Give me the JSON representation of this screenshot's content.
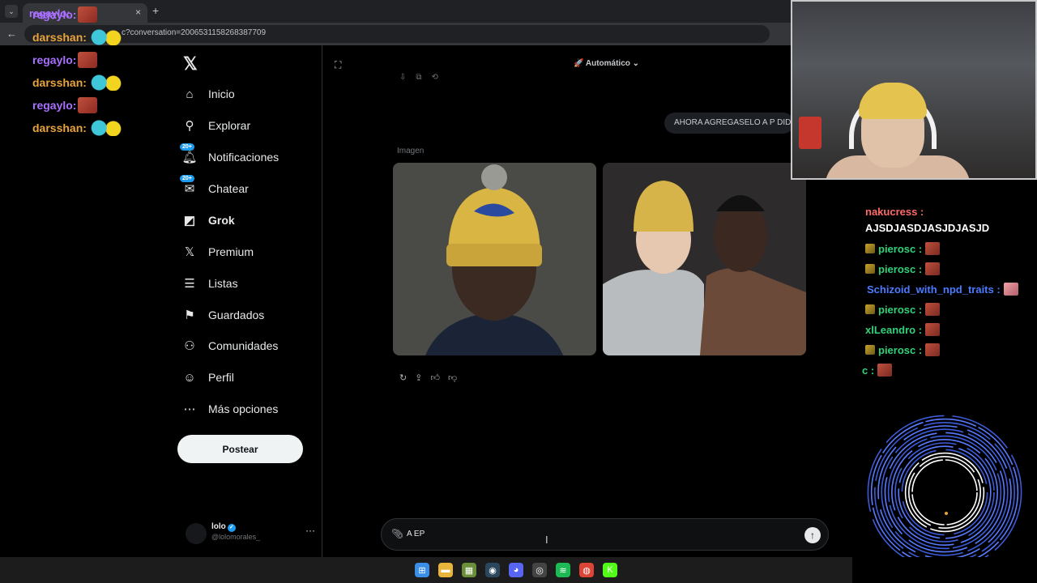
{
  "browser": {
    "tab_title": "regaylo:",
    "tab_close": "×",
    "new_tab": "+",
    "back": "←",
    "url": "c?conversation=2006531158268387709"
  },
  "stream_chat_left": [
    {
      "user": "regaylo:",
      "color": "#a970ff",
      "emote": "red"
    },
    {
      "user": "darsshan:",
      "color": "#e8a33a",
      "emote": "duck"
    },
    {
      "user": "regaylo:",
      "color": "#a970ff",
      "emote": "red"
    },
    {
      "user": "darsshan:",
      "color": "#e8a33a",
      "emote": "duck"
    },
    {
      "user": "regaylo:",
      "color": "#a970ff",
      "emote": "red"
    },
    {
      "user": "darsshan:",
      "color": "#e8a33a",
      "emote": "duck"
    }
  ],
  "sidebar": {
    "logo": "𝕏",
    "items": [
      {
        "label": "Inicio",
        "icon": "home-icon",
        "glyph": "⌂"
      },
      {
        "label": "Explorar",
        "icon": "search-icon",
        "glyph": "⚲"
      },
      {
        "label": "Notificaciones",
        "icon": "bell-icon",
        "glyph": "🔔︎",
        "badge": "20+"
      },
      {
        "label": "Chatear",
        "icon": "mail-icon",
        "glyph": "✉",
        "badge": "20+"
      },
      {
        "label": "Grok",
        "icon": "grok-icon",
        "glyph": "◩",
        "active": true
      },
      {
        "label": "Premium",
        "icon": "x-premium-icon",
        "glyph": "𝕏"
      },
      {
        "label": "Listas",
        "icon": "list-icon",
        "glyph": "☰"
      },
      {
        "label": "Guardados",
        "icon": "bookmark-icon",
        "glyph": "⚑"
      },
      {
        "label": "Comunidades",
        "icon": "communities-icon",
        "glyph": "⚇"
      },
      {
        "label": "Perfil",
        "icon": "person-icon",
        "glyph": "☺"
      },
      {
        "label": "Más opciones",
        "icon": "more-circle-icon",
        "glyph": "⋯"
      }
    ],
    "post_button": "Postear",
    "profile": {
      "name": "lolo",
      "handle": "@lolomorales_",
      "verified": "✓",
      "more": "···"
    }
  },
  "main": {
    "mode": "🚀 Automático ⌄",
    "user_message": "AHORA AGREGASELO A P DIDDY",
    "image_label": "Imagen",
    "actions": [
      "↻",
      "⇪",
      "👍︎",
      "👎︎"
    ],
    "top_actions": [
      "⇩",
      "⧉",
      "⟲"
    ],
    "composer": {
      "text": "A EP",
      "attach": "📎︎",
      "send": "↑"
    }
  },
  "stream_chat_right": [
    {
      "user": "nakucress :",
      "color": "#ff6b6b"
    },
    {
      "text": "AJSDJASDJASJDJASJD",
      "color": "#ffffff"
    },
    {
      "user": "pierosc :",
      "color": "#33d17a",
      "emote": "red"
    },
    {
      "user": "pierosc :",
      "color": "#33d17a",
      "emote": "red"
    },
    {
      "user": "Schizoid_with_npd_traits :",
      "color": "#4b7bff",
      "emote": "pink"
    },
    {
      "user": "pierosc :",
      "color": "#33d17a",
      "emote": "red"
    },
    {
      "user": "xlLeandro :",
      "color": "#33d17a",
      "emote": "red"
    },
    {
      "user": "pierosc :",
      "color": "#33d17a",
      "emote": "red"
    },
    {
      "user": "c :",
      "color": "#33d17a",
      "emote": "red"
    }
  ],
  "taskbar": {
    "icons": [
      {
        "name": "windows-start-icon",
        "glyph": "⊞",
        "color": "#3a8ee6"
      },
      {
        "name": "file-explorer-icon",
        "glyph": "▬",
        "color": "#e8b53a"
      },
      {
        "name": "app-icon",
        "glyph": "▦",
        "color": "#6a8f3a"
      },
      {
        "name": "steam-icon",
        "glyph": "◉",
        "color": "#2a475e"
      },
      {
        "name": "discord-icon",
        "glyph": "◕",
        "color": "#5865f2"
      },
      {
        "name": "obs-icon",
        "glyph": "◎",
        "color": "#444444"
      },
      {
        "name": "spotify-icon",
        "glyph": "≋",
        "color": "#1db954"
      },
      {
        "name": "chrome-icon",
        "glyph": "◍",
        "color": "#db4437"
      },
      {
        "name": "kick-icon",
        "glyph": "K",
        "color": "#53fc18"
      }
    ]
  }
}
